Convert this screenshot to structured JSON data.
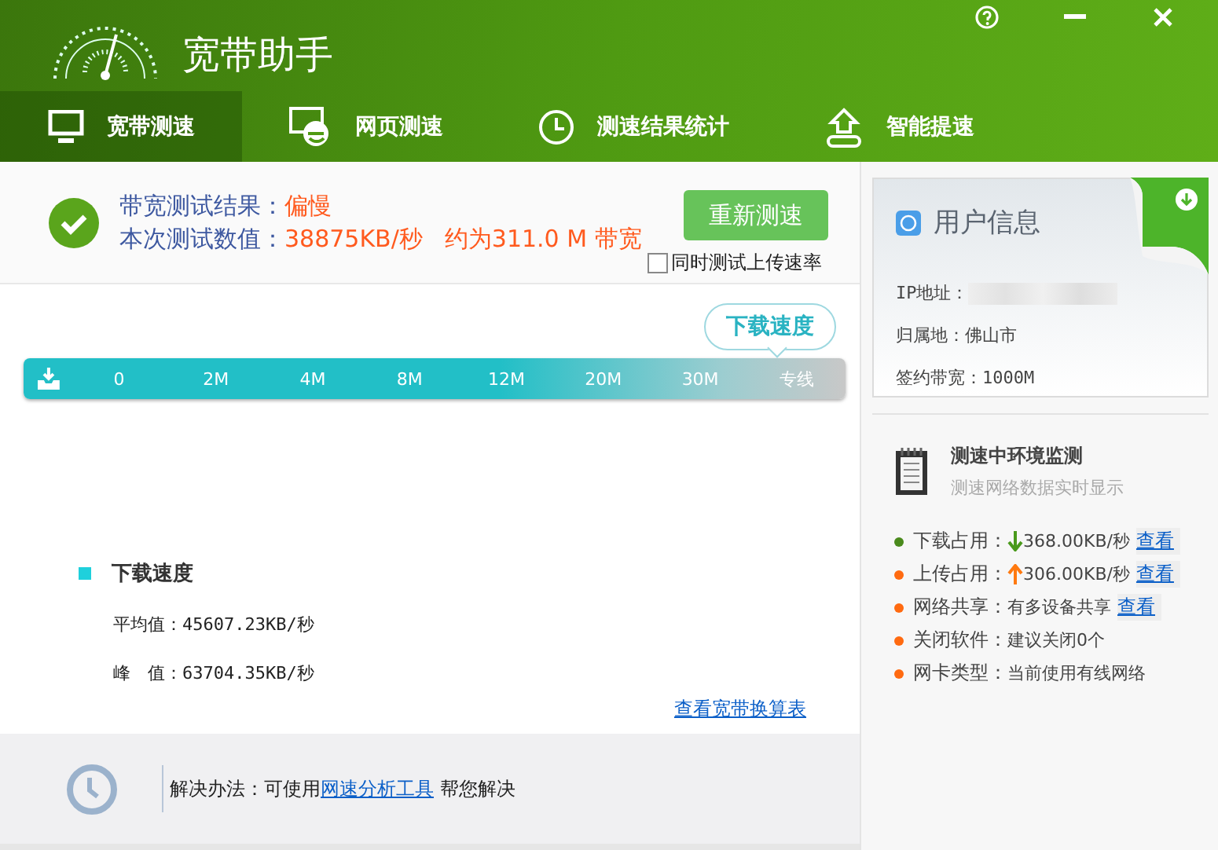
{
  "window": {
    "title": "宽带助手"
  },
  "tabs": [
    {
      "label": "宽带测速",
      "selected": true,
      "kind": "monitor"
    },
    {
      "label": "网页测速",
      "selected": false,
      "kind": "browser"
    },
    {
      "label": "测速结果统计",
      "selected": false,
      "kind": "clock"
    },
    {
      "label": "智能提速",
      "selected": false,
      "kind": "boost"
    }
  ],
  "result": {
    "result_label": "带宽测试结果：",
    "verdict": "偏慢",
    "value_label": "本次测试数值：",
    "value": "38875KB/秒",
    "approx": "约为311.0 M 带宽",
    "retest_button": "重新测速",
    "upload_checkbox": {
      "label": "同时测试上传速率",
      "checked": false
    }
  },
  "speed_scale": {
    "bubble": "下载速度",
    "ticks": [
      "0",
      "2M",
      "4M",
      "8M",
      "12M",
      "20M",
      "30M",
      "专线"
    ]
  },
  "download_stats": {
    "title": "下载速度",
    "rows": [
      {
        "label": "平均值：",
        "value": "45607.23KB/秒"
      },
      {
        "label": "峰　值：",
        "value": "63704.35KB/秒"
      }
    ],
    "link": "查看宽带换算表"
  },
  "footer": {
    "prefix": "解决办法：可使用",
    "link": "网速分析工具",
    "suffix": "帮您解决"
  },
  "user_info": {
    "title": "用户信息",
    "fields": [
      {
        "label": "IP地址：",
        "kind": "blurred"
      },
      {
        "label": "归属地：",
        "value": "佛山市",
        "kind": "text"
      },
      {
        "label": "签约带宽：",
        "value": "1000M",
        "kind": "text"
      }
    ]
  },
  "monitor": {
    "title": "测速中环境监测",
    "subtitle": "测速网络数据实时显示",
    "items": [
      {
        "label": "下载占用：",
        "value": "368.00KB/秒",
        "kind": "download",
        "color": "#4a8a1c",
        "link": "查看"
      },
      {
        "label": "上传占用：",
        "value": "306.00KB/秒",
        "kind": "upload",
        "color": "#ff6a10",
        "link": "查看"
      },
      {
        "label": "网络共享：",
        "value": "有多设备共享",
        "kind": "plain",
        "color": "#ff6a10",
        "link": "查看"
      },
      {
        "label": "关闭软件：",
        "value": "建议关闭0个",
        "kind": "plain",
        "color": "#ff6a10"
      },
      {
        "label": "网卡类型：",
        "value": "当前使用有线网络",
        "kind": "plain",
        "color": "#ff6a10"
      }
    ]
  }
}
